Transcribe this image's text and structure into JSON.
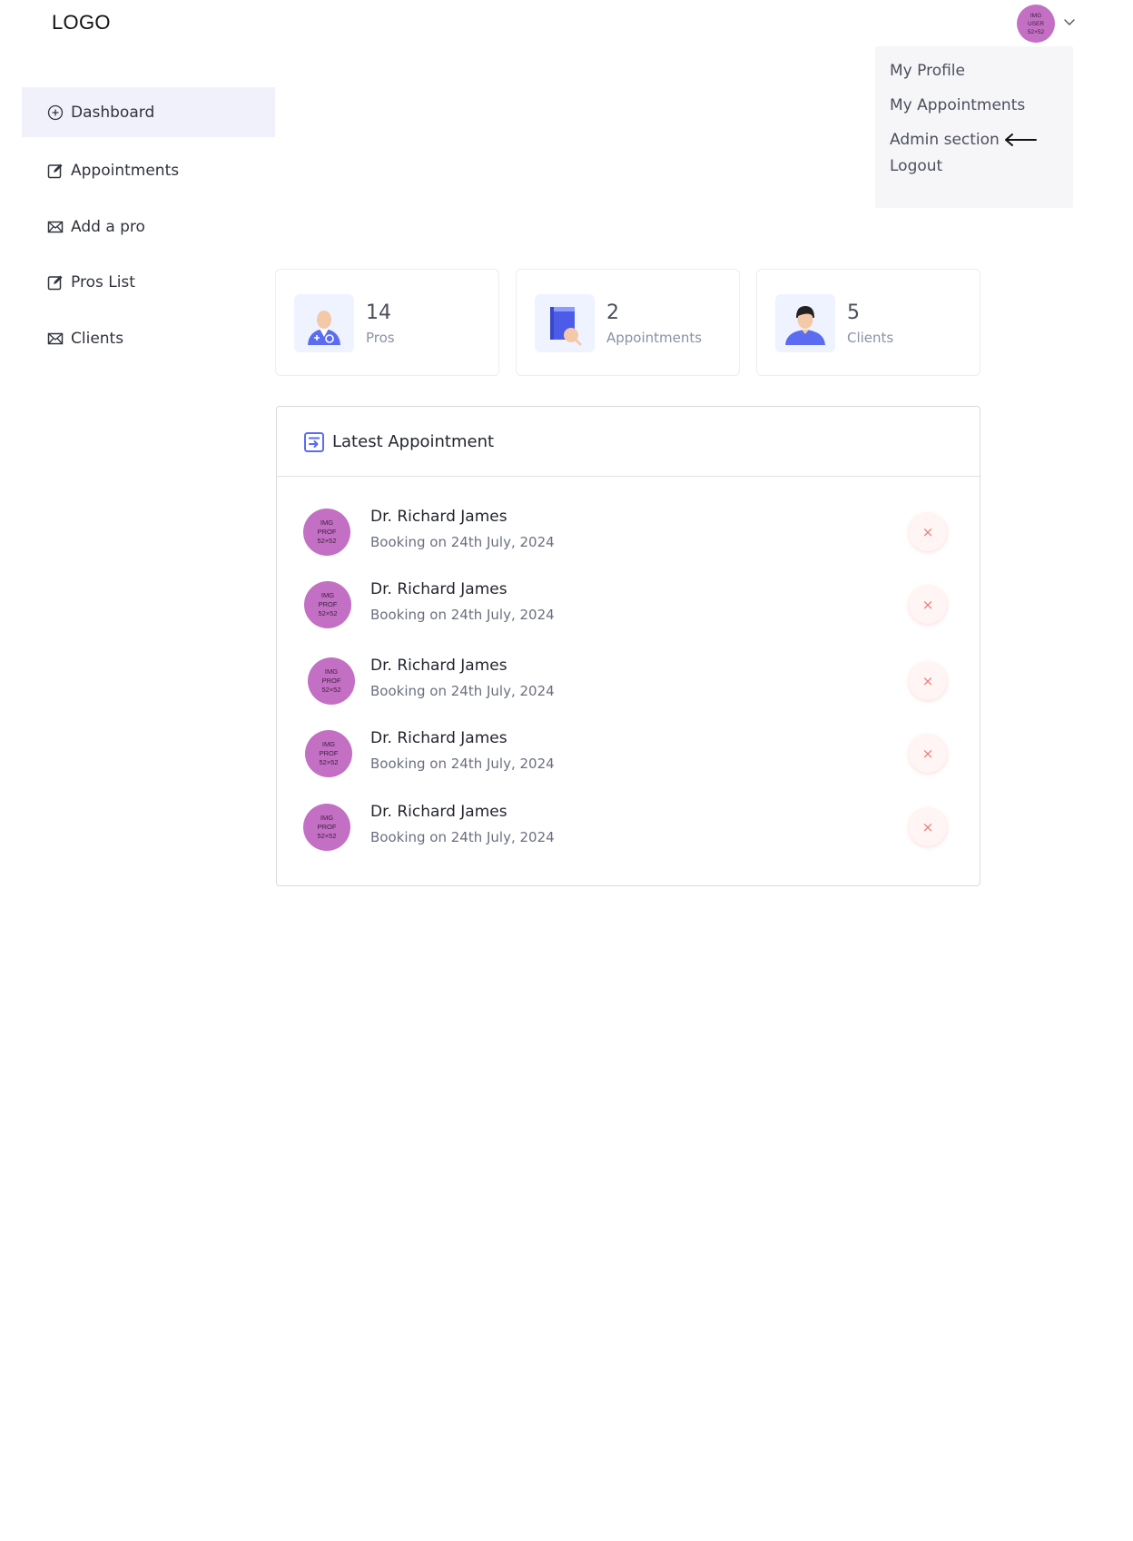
{
  "header": {
    "logo": "LOGO",
    "user_avatar_text": "IMG\nUSER\n52×52"
  },
  "user_menu": {
    "items": [
      {
        "label": "My Profile"
      },
      {
        "label": "My Appointments"
      },
      {
        "label": "Admin section"
      },
      {
        "label": "Logout"
      }
    ]
  },
  "sidebar": {
    "items": [
      {
        "label": "Dashboard",
        "icon": "plus-circle-icon",
        "active": true
      },
      {
        "label": "Appointments",
        "icon": "edit-square-icon"
      },
      {
        "label": "Add a pro",
        "icon": "mail-icon"
      },
      {
        "label": "Pros List",
        "icon": "edit-square-icon"
      },
      {
        "label": "Clients",
        "icon": "mail-icon"
      }
    ]
  },
  "stats": [
    {
      "value": "14",
      "label": "Pros",
      "icon": "doctor-icon"
    },
    {
      "value": "2",
      "label": "Appointments",
      "icon": "book-icon"
    },
    {
      "value": "5",
      "label": "Clients",
      "icon": "client-icon"
    }
  ],
  "latest": {
    "title": "Latest Appointment",
    "avatar_text": "IMG\nPROF\n52×52",
    "rows": [
      {
        "name": "Dr. Richard James",
        "booking": "Booking on 24th July, 2024"
      },
      {
        "name": "Dr. Richard James",
        "booking": "Booking on 24th July, 2024"
      },
      {
        "name": "Dr. Richard James",
        "booking": "Booking on 24th July, 2024"
      },
      {
        "name": "Dr. Richard James",
        "booking": "Booking on 24th July, 2024"
      },
      {
        "name": "Dr. Richard James",
        "booking": "Booking on 24th July, 2024"
      }
    ],
    "cancel_glyph": "×"
  },
  "colors": {
    "accent": "#5b6cf0",
    "avatar": "#c370c4",
    "active_bg": "#f1f1fc",
    "cancel": "#f07a7a"
  }
}
